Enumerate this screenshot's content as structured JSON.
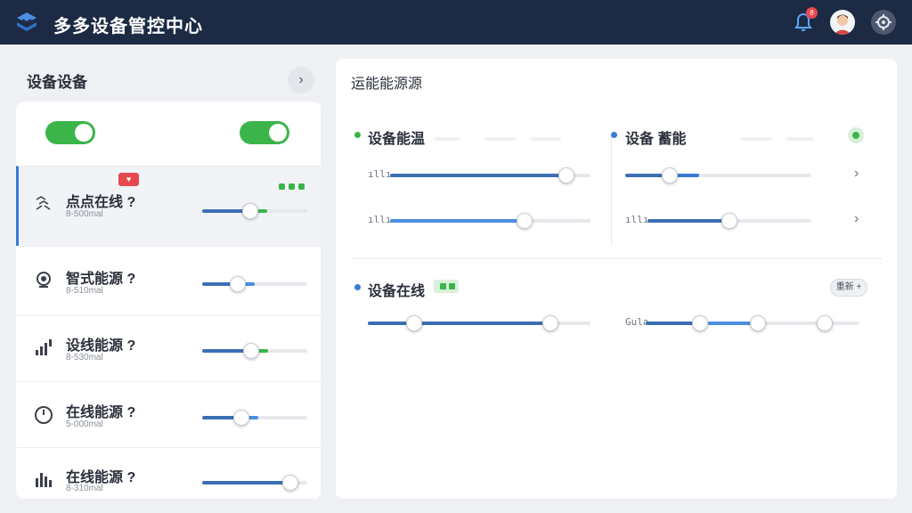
{
  "header": {
    "app_title": "多多设备管控中心",
    "notification_count": "8",
    "icons": {
      "logo": "layers-logo-icon",
      "bell": "bell-icon",
      "avatar": "user-avatar",
      "settings": "gear-icon"
    }
  },
  "left_panel": {
    "title": "设备设备",
    "next_label": "›",
    "toggles": [
      {
        "state": "on"
      },
      {
        "state": "on"
      }
    ],
    "devices": [
      {
        "name": "点点在线 ?",
        "sub": "8-500mal",
        "icon": "network-icon",
        "level": 0.46,
        "alert": "♥",
        "active": true
      },
      {
        "name": "智式能源 ?",
        "sub": "8-510mal",
        "icon": "webcam-icon",
        "level": 0.34
      },
      {
        "name": "设线能源 ?",
        "sub": "8-530mal",
        "icon": "signal-icon",
        "level": 0.47
      },
      {
        "name": "在线能源 ?",
        "sub": "5-000mal",
        "icon": "gauge-icon",
        "level": 0.37
      },
      {
        "name": "在线能源 ?",
        "sub": "8-310mal",
        "icon": "bar-chart-icon",
        "level": 0.84
      }
    ]
  },
  "right_panel": {
    "title": "运能能源源",
    "section1": {
      "title": "设备能温",
      "levels": [
        0.88,
        0.67
      ]
    },
    "section2": {
      "title": "设备 蓄能",
      "levels": [
        0.24,
        0.5
      ]
    },
    "section3": {
      "title": "设备在线",
      "button_label": "重新 +",
      "levels": [
        0.21,
        0.82
      ]
    },
    "mini_label": "Gula",
    "chevron": "›",
    "accent_color": "#3b6fb4",
    "status_color": "#3bb54a"
  }
}
